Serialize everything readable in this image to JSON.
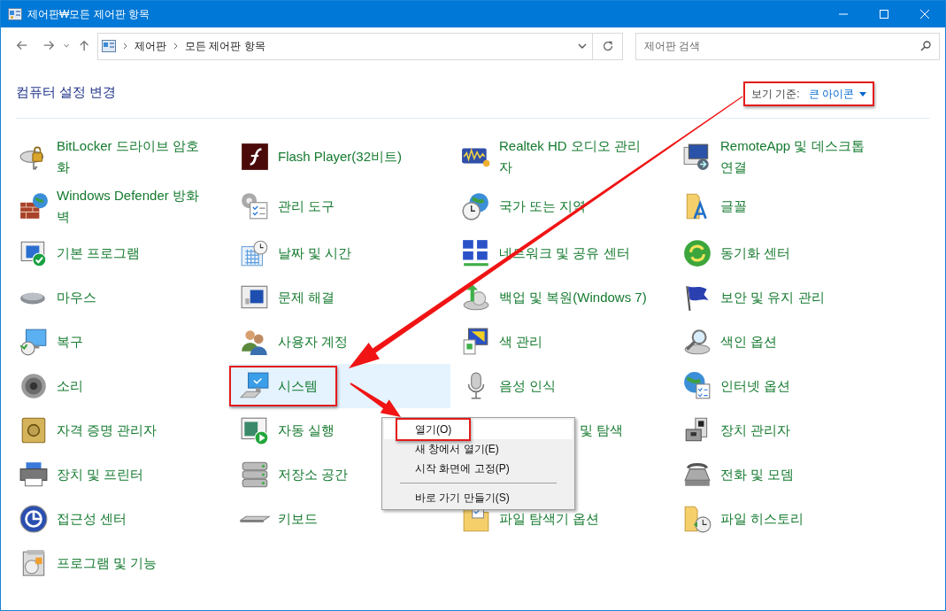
{
  "window": {
    "title": "제어판₩모든 제어판 항목"
  },
  "address_bar": {
    "crumbs": [
      "제어판",
      "모든 제어판 항목"
    ]
  },
  "search": {
    "placeholder": "제어판 검색"
  },
  "heading": "컴퓨터 설정 변경",
  "view_by": {
    "label": "보기 기준:",
    "value": "큰 아이콘",
    "annotated": true
  },
  "columns": [
    {
      "items": [
        {
          "kind": "item",
          "label": "BitLocker 드라이브 암호화",
          "selected": false,
          "annotated": false
        },
        {
          "kind": "item",
          "label": "Windows Defender 방화벽",
          "selected": false,
          "annotated": false
        },
        {
          "kind": "item",
          "label": "기본 프로그램",
          "selected": false,
          "annotated": false
        },
        {
          "kind": "item",
          "label": "마우스",
          "selected": false,
          "annotated": false
        },
        {
          "kind": "item",
          "label": "복구",
          "selected": false,
          "annotated": false
        },
        {
          "kind": "item",
          "label": "소리",
          "selected": false,
          "annotated": false
        },
        {
          "kind": "item",
          "label": "자격 증명 관리자",
          "selected": false,
          "annotated": false
        },
        {
          "kind": "item",
          "label": "장치 및 프린터",
          "selected": false,
          "annotated": false
        },
        {
          "kind": "item",
          "label": "접근성 센터",
          "selected": false,
          "annotated": false
        },
        {
          "kind": "item",
          "label": "프로그램 및 기능",
          "selected": false,
          "annotated": false
        }
      ]
    },
    {
      "items": [
        {
          "kind": "item",
          "label": "Flash Player(32비트)",
          "selected": false,
          "annotated": false
        },
        {
          "kind": "item",
          "label": "관리 도구",
          "selected": false,
          "annotated": false
        },
        {
          "kind": "item",
          "label": "날짜 및 시간",
          "selected": false,
          "annotated": false
        },
        {
          "kind": "item",
          "label": "문제 해결",
          "selected": false,
          "annotated": false
        },
        {
          "kind": "item",
          "label": "사용자 계정",
          "selected": false,
          "annotated": false
        },
        {
          "kind": "item",
          "label": "시스템",
          "selected": true,
          "annotated": true
        },
        {
          "kind": "item",
          "label": "자동 실행",
          "selected": false,
          "annotated": false
        },
        {
          "kind": "item",
          "label": "저장소 공간",
          "selected": false,
          "annotated": false
        },
        {
          "kind": "item",
          "label": "키보드",
          "selected": false,
          "annotated": false
        }
      ]
    },
    {
      "items": [
        {
          "kind": "item",
          "label": "Realtek HD 오디오 관리자",
          "selected": false,
          "annotated": false
        },
        {
          "kind": "item",
          "label": "국가 또는 지역",
          "selected": false,
          "annotated": false
        },
        {
          "kind": "item",
          "label": "네트워크 및 공유 센터",
          "selected": false,
          "annotated": false
        },
        {
          "kind": "item",
          "label": "백업 및 복원(Windows 7)",
          "selected": false,
          "annotated": false
        },
        {
          "kind": "item",
          "label": "색 관리",
          "selected": false,
          "annotated": false
        },
        {
          "kind": "item",
          "label": "음성 인식",
          "selected": false,
          "annotated": false
        },
        {
          "kind": "covered",
          "label": "및 탐색"
        },
        {
          "kind": "item",
          "label": "파일 탐색기 옵션",
          "selected": false,
          "annotated": false
        }
      ]
    },
    {
      "items": [
        {
          "kind": "item",
          "label": "RemoteApp 및 데스크톱 연결",
          "selected": false,
          "annotated": false
        },
        {
          "kind": "item",
          "label": "글꼴",
          "selected": false,
          "annotated": false
        },
        {
          "kind": "item",
          "label": "동기화 센터",
          "selected": false,
          "annotated": false
        },
        {
          "kind": "item",
          "label": "보안 및 유지 관리",
          "selected": false,
          "annotated": false
        },
        {
          "kind": "item",
          "label": "색인 옵션",
          "selected": false,
          "annotated": false
        },
        {
          "kind": "item",
          "label": "인터넷 옵션",
          "selected": false,
          "annotated": false
        },
        {
          "kind": "item",
          "label": "장치 관리자",
          "selected": false,
          "annotated": false
        },
        {
          "kind": "item",
          "label": "전화 및 모뎀",
          "selected": false,
          "annotated": false
        },
        {
          "kind": "item",
          "label": "파일 히스토리",
          "selected": false,
          "annotated": false
        }
      ]
    }
  ],
  "context_menu": {
    "items": [
      {
        "kind": "item",
        "label": "열기(O)",
        "selected": true,
        "annotated": true
      },
      {
        "kind": "item",
        "label": "새 창에서 열기(E)",
        "selected": false,
        "annotated": false
      },
      {
        "kind": "item",
        "label": "시작 화면에 고정(P)",
        "selected": false,
        "annotated": false
      },
      {
        "kind": "separator"
      },
      {
        "kind": "item",
        "label": "바로 가기 만들기(S)",
        "selected": false,
        "annotated": false
      }
    ]
  }
}
